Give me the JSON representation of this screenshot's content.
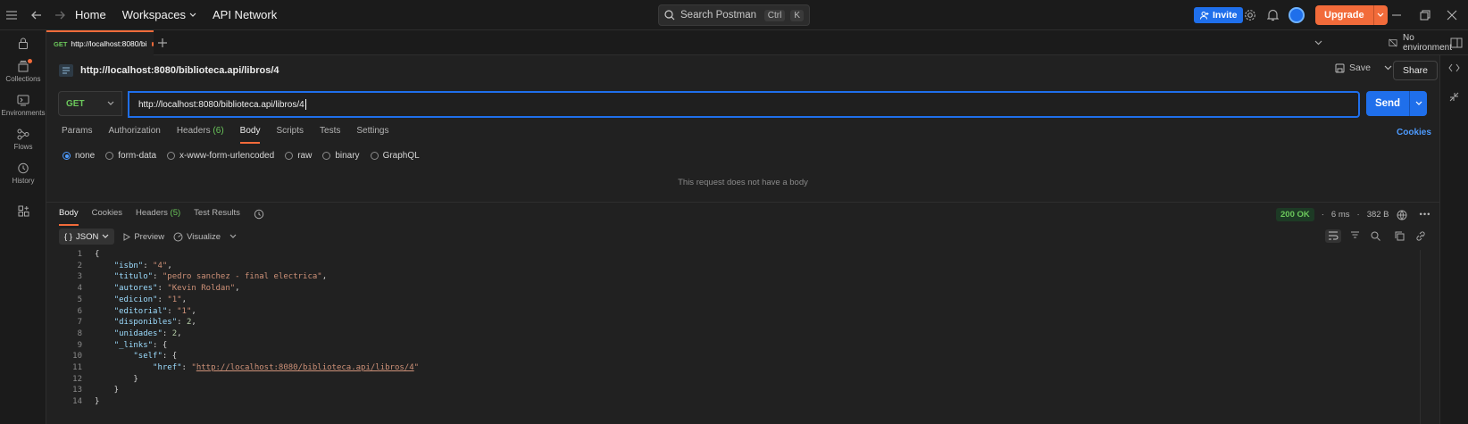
{
  "topbar": {
    "home": "Home",
    "workspaces": "Workspaces",
    "api_network": "API Network",
    "search_placeholder": "Search Postman",
    "shortcut_ctrl": "Ctrl",
    "shortcut_k": "K",
    "invite": "Invite",
    "upgrade": "Upgrade"
  },
  "sidebar": {
    "items": [
      {
        "label": "Collections"
      },
      {
        "label": "Environments"
      },
      {
        "label": "Flows"
      },
      {
        "label": "History"
      }
    ]
  },
  "tabbar": {
    "tab_method": "GET",
    "tab_label": "http://localhost:8080/bi",
    "environment": "No environment"
  },
  "request": {
    "title": "http://localhost:8080/biblioteca.api/libros/4",
    "save": "Save",
    "share": "Share",
    "method": "GET",
    "url": "http://localhost:8080/biblioteca.api/libros/4",
    "send": "Send",
    "tabs": {
      "params": "Params",
      "authorization": "Authorization",
      "headers": "Headers",
      "headers_count": "(6)",
      "body": "Body",
      "scripts": "Scripts",
      "tests": "Tests",
      "settings": "Settings"
    },
    "cookies": "Cookies",
    "body_types": [
      "none",
      "form-data",
      "x-www-form-urlencoded",
      "raw",
      "binary",
      "GraphQL"
    ],
    "no_body": "This request does not have a body"
  },
  "response": {
    "tabs": {
      "body": "Body",
      "cookies": "Cookies",
      "headers": "Headers",
      "headers_count": "(5)",
      "test_results": "Test Results"
    },
    "status": "200 OK",
    "time": "6 ms",
    "size": "382 B",
    "format": "JSON",
    "preview": "Preview",
    "visualize": "Visualize",
    "line_numbers": [
      "1",
      "2",
      "3",
      "4",
      "5",
      "6",
      "7",
      "8",
      "9",
      "10",
      "11",
      "12",
      "13",
      "14"
    ],
    "json": {
      "isbn": "\"4\"",
      "titulo": "\"pedro sanchez - final electrica\"",
      "autores": "\"Kevin Roldan\"",
      "edicion": "\"1\"",
      "editorial": "\"1\"",
      "disponibles": "2",
      "unidades": "2",
      "href": "http://localhost:8080/biblioteca.api/libros/4"
    }
  },
  "colors": {
    "accent": "#f26b3a",
    "primary": "#1f6feb",
    "method_get": "#6bc75b"
  }
}
